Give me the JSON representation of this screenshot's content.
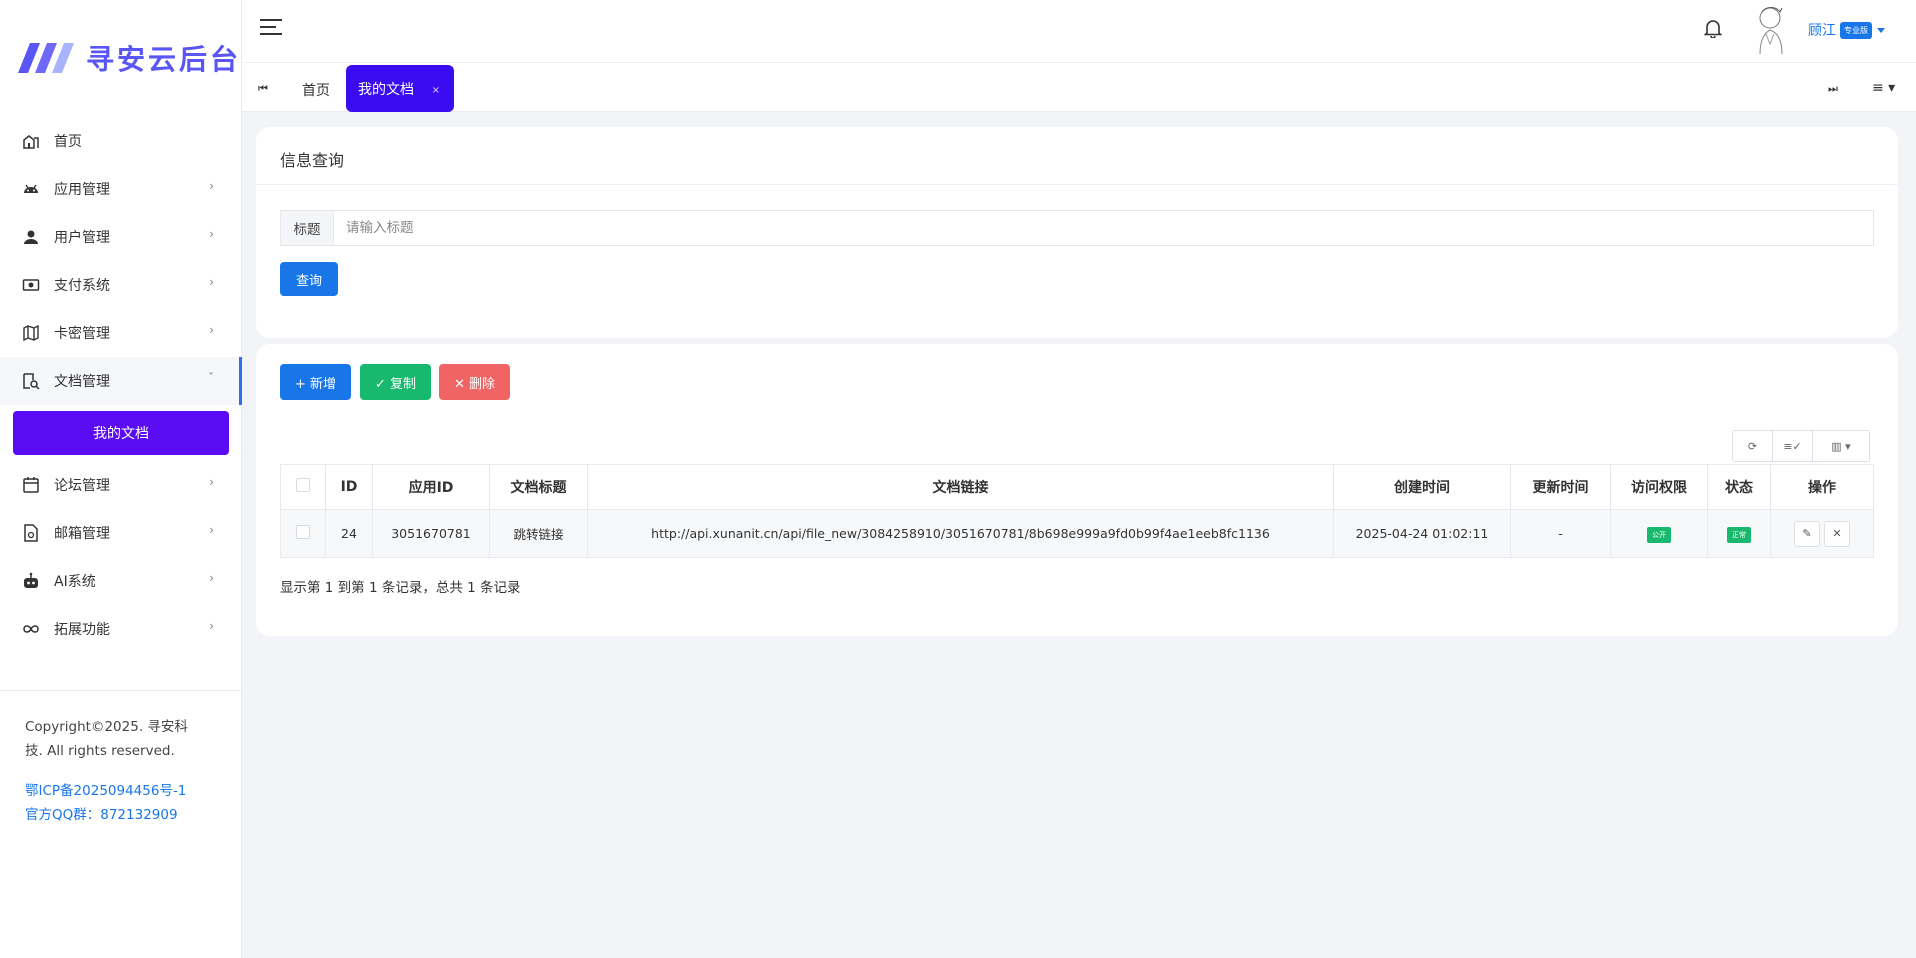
{
  "brand": {
    "name": "寻安云后台",
    "accent": "#5a56f5"
  },
  "sidebar": {
    "items": [
      {
        "label": "首页",
        "icon": "home-icon"
      },
      {
        "label": "应用管理",
        "icon": "android-icon"
      },
      {
        "label": "用户管理",
        "icon": "user-icon"
      },
      {
        "label": "支付系统",
        "icon": "money-icon"
      },
      {
        "label": "卡密管理",
        "icon": "map-icon"
      },
      {
        "label": "文档管理",
        "icon": "doc-search-icon"
      },
      {
        "label": "论坛管理",
        "icon": "calendar-icon"
      },
      {
        "label": "邮箱管理",
        "icon": "mail-doc-icon"
      },
      {
        "label": "AI系统",
        "icon": "robot-icon"
      },
      {
        "label": "拓展功能",
        "icon": "infinity-icon"
      }
    ],
    "sub_active": "我的文档",
    "footer": {
      "copyright": "Copyright©2025. 寻安科技. All rights reserved.",
      "icp": "鄂ICP备2025094456号-1",
      "qq": "官方QQ群：872132909"
    }
  },
  "header": {
    "user_name": "顾江",
    "user_badge": "专业版"
  },
  "tabs": {
    "home": "首页",
    "active": "我的文档",
    "close": "×"
  },
  "search": {
    "title": "信息查询",
    "field_label": "标题",
    "placeholder": "请输入标题",
    "query_label": "查询"
  },
  "toolbar": {
    "add_label": "+ 新增",
    "copy_label": "✓ 复制",
    "delete_label": "✕ 删除"
  },
  "table": {
    "headers": [
      "ID",
      "应用ID",
      "文档标题",
      "文档链接",
      "创建时间",
      "更新时间",
      "访问权限",
      "状态",
      "操作"
    ],
    "rows": [
      {
        "id": "24",
        "app_id": "3051670781",
        "title": "跳转链接",
        "link": "http://api.xunanit.cn/api/file_new/3084258910/3051670781/8b698e999a9fd0b99f4ae1eeb8fc1136",
        "created": "2025-04-24 01:02:11",
        "updated": "-",
        "access": "公开",
        "status": "正常"
      }
    ]
  },
  "pager": {
    "summary": "显示第 1 到第 1 条记录，总共 1 条记录"
  }
}
